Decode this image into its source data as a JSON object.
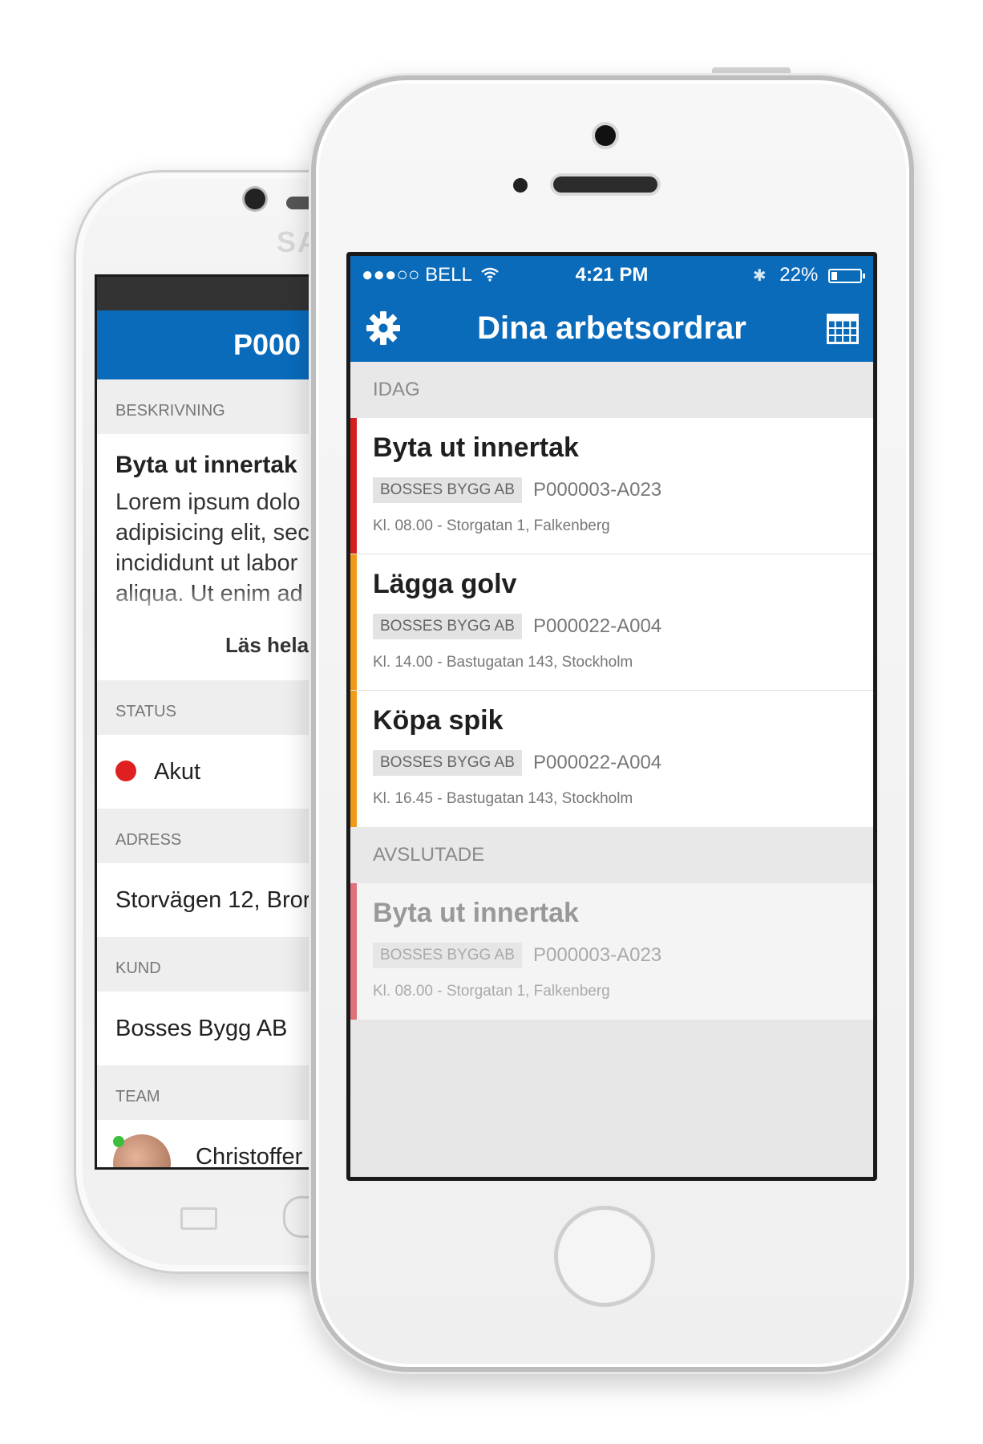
{
  "android": {
    "brand": "SA",
    "app_title": "P000",
    "sections": {
      "description": "BESKRIVNING",
      "status": "STATUS",
      "address": "ADRESS",
      "customer": "KUND",
      "team": "TEAM"
    },
    "description_title": "Byta ut innertak",
    "description_lines": [
      "Lorem ipsum dolo",
      "adipisicing elit, sec",
      "incididunt ut labor",
      "aliqua. Ut enim ad"
    ],
    "read_more": "Läs hela",
    "status_value": "Akut",
    "status_color": "#e02020",
    "address_value": "Storvägen 12, Bror",
    "customer_value": "Bosses Bygg AB",
    "team_member_partial": "Christoffer"
  },
  "iphone": {
    "status_bar": {
      "signal": "●●●○○",
      "carrier": "BELL",
      "time": "4:21 PM",
      "bluetooth": "✱",
      "battery": "22%",
      "battery_level": 0.22
    },
    "nav": {
      "title": "Dina arbetsordrar",
      "left_icon": "gear-icon",
      "right_icon": "calendar-icon"
    },
    "accent_color": "#0a6bbb",
    "sections": [
      {
        "label": "IDAG",
        "orders": [
          {
            "title": "Byta ut innertak",
            "customer": "BOSSES BYGG AB",
            "code": "P000003-A023",
            "meta": "Kl. 08.00 - Storgatan 1, Falkenberg",
            "color": "#d62020"
          },
          {
            "title": "Lägga golv",
            "customer": "BOSSES BYGG AB",
            "code": "P000022-A004",
            "meta": "Kl. 14.00 - Bastugatan 143, Stockholm",
            "color": "#f09a1a"
          },
          {
            "title": "Köpa spik",
            "customer": "BOSSES BYGG AB",
            "code": "P000022-A004",
            "meta": "Kl. 16.45 - Bastugatan 143, Stockholm",
            "color": "#f09a1a"
          }
        ]
      },
      {
        "label": "AVSLUTADE",
        "orders": [
          {
            "title": "Byta ut innertak",
            "customer": "BOSSES BYGG AB",
            "code": "P000003-A023",
            "meta": "Kl. 08.00 - Storgatan 1, Falkenberg",
            "color": "#e0707a"
          }
        ]
      }
    ]
  }
}
